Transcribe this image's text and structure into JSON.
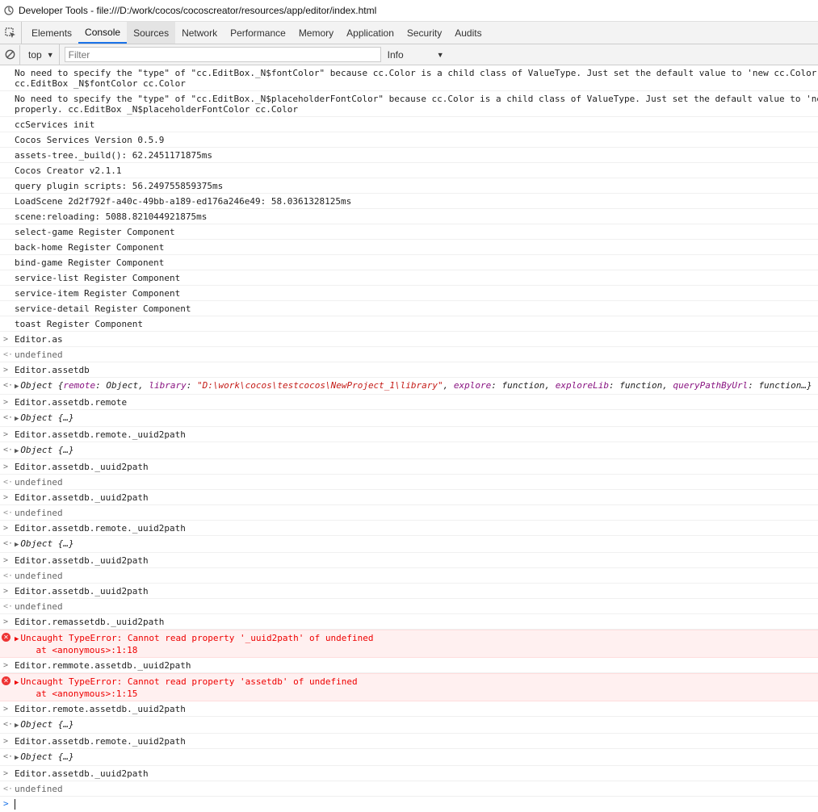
{
  "window": {
    "title": "Developer Tools - file:///D:/work/cocos/cocoscreator/resources/app/editor/index.html"
  },
  "tabs": [
    "Elements",
    "Console",
    "Sources",
    "Network",
    "Performance",
    "Memory",
    "Application",
    "Security",
    "Audits"
  ],
  "toolbar": {
    "context": "top",
    "filter_placeholder": "Filter",
    "level": "Info"
  },
  "log": [
    {
      "type": "log",
      "text": "No need to specify the \"type\" of \"cc.EditBox._N$fontColor\" because cc.Color is a child class of ValueType. Just set the default value to 'new cc.Color(",
      "text2": "cc.EditBox _N$fontColor cc.Color"
    },
    {
      "type": "log",
      "text": "No need to specify the \"type\" of \"cc.EditBox._N$placeholderFontColor\" because cc.Color is a child class of ValueType. Just set the default value to 'ne",
      "text2": "properly. cc.EditBox _N$placeholderFontColor cc.Color"
    },
    {
      "type": "log",
      "text": "ccServices init"
    },
    {
      "type": "log",
      "text": "Cocos Services Version 0.5.9"
    },
    {
      "type": "log",
      "text": "assets-tree._build(): 62.2451171875ms"
    },
    {
      "type": "log",
      "text": "Cocos Creator v2.1.1"
    },
    {
      "type": "log",
      "text": "query plugin scripts: 56.249755859375ms"
    },
    {
      "type": "log",
      "text": "LoadScene 2d2f792f-a40c-49bb-a189-ed176a246e49: 58.0361328125ms"
    },
    {
      "type": "log",
      "text": "scene:reloading: 5088.821044921875ms"
    },
    {
      "type": "log",
      "text": "select-game Register Component"
    },
    {
      "type": "log",
      "text": "back-home Register Component"
    },
    {
      "type": "log",
      "text": "bind-game Register Component"
    },
    {
      "type": "log",
      "text": "service-list Register Component"
    },
    {
      "type": "log",
      "text": "service-item Register Component"
    },
    {
      "type": "log",
      "text": "service-detail Register Component"
    },
    {
      "type": "log",
      "text": "toast Register Component"
    },
    {
      "type": "cmd",
      "text": "Editor.as"
    },
    {
      "type": "result",
      "text": "undefined"
    },
    {
      "type": "cmd",
      "text": "Editor.assetdb"
    },
    {
      "type": "objdetail",
      "text": "Object {remote: Object, library: \"D:\\work\\cocos\\testcocos\\NewProject_1\\library\", explore: function, exploreLib: function, queryPathByUrl: function…}"
    },
    {
      "type": "cmd",
      "text": "Editor.assetdb.remote"
    },
    {
      "type": "obj",
      "text": "Object {…}"
    },
    {
      "type": "cmd",
      "text": "Editor.assetdb.remote._uuid2path"
    },
    {
      "type": "obj",
      "text": "Object {…}"
    },
    {
      "type": "cmd",
      "text": "Editor.assetdb._uuid2path"
    },
    {
      "type": "result",
      "text": "undefined"
    },
    {
      "type": "cmd",
      "text": "Editor.assetdb._uuid2path"
    },
    {
      "type": "result",
      "text": "undefined"
    },
    {
      "type": "cmd",
      "text": "Editor.assetdb.remote._uuid2path"
    },
    {
      "type": "obj",
      "text": "Object {…}"
    },
    {
      "type": "cmd",
      "text": "Editor.assetdb._uuid2path"
    },
    {
      "type": "result",
      "text": "undefined"
    },
    {
      "type": "cmd",
      "text": "Editor.assetdb._uuid2path"
    },
    {
      "type": "result",
      "text": "undefined"
    },
    {
      "type": "cmd",
      "text": "Editor.remassetdb._uuid2path"
    },
    {
      "type": "error",
      "text": "Uncaught TypeError: Cannot read property '_uuid2path' of undefined",
      "text2": "    at <anonymous>:1:18"
    },
    {
      "type": "cmd",
      "text": "Editor.remmote.assetdb._uuid2path"
    },
    {
      "type": "error",
      "text": "Uncaught TypeError: Cannot read property 'assetdb' of undefined",
      "text2": "    at <anonymous>:1:15"
    },
    {
      "type": "cmd",
      "text": "Editor.remote.assetdb._uuid2path"
    },
    {
      "type": "obj",
      "text": "Object {…}"
    },
    {
      "type": "cmd",
      "text": "Editor.assetdb.remote._uuid2path"
    },
    {
      "type": "obj",
      "text": "Object {…}"
    },
    {
      "type": "cmd",
      "text": "Editor.assetdb._uuid2path"
    },
    {
      "type": "result",
      "text": "undefined"
    }
  ],
  "object_detail": {
    "prefix": "Object {",
    "pairs": [
      {
        "key": "remote",
        "sep": ": ",
        "val": "Object",
        "kind": "v"
      },
      {
        "key": "library",
        "sep": ": ",
        "val": "\"D:\\work\\cocos\\testcocos\\NewProject_1\\library\"",
        "kind": "s"
      },
      {
        "key": "explore",
        "sep": ": ",
        "val": "function",
        "kind": "v"
      },
      {
        "key": "exploreLib",
        "sep": ": ",
        "val": "function",
        "kind": "v"
      },
      {
        "key": "queryPathByUrl",
        "sep": ": ",
        "val": "function…",
        "kind": "v"
      }
    ],
    "suffix": "}"
  }
}
